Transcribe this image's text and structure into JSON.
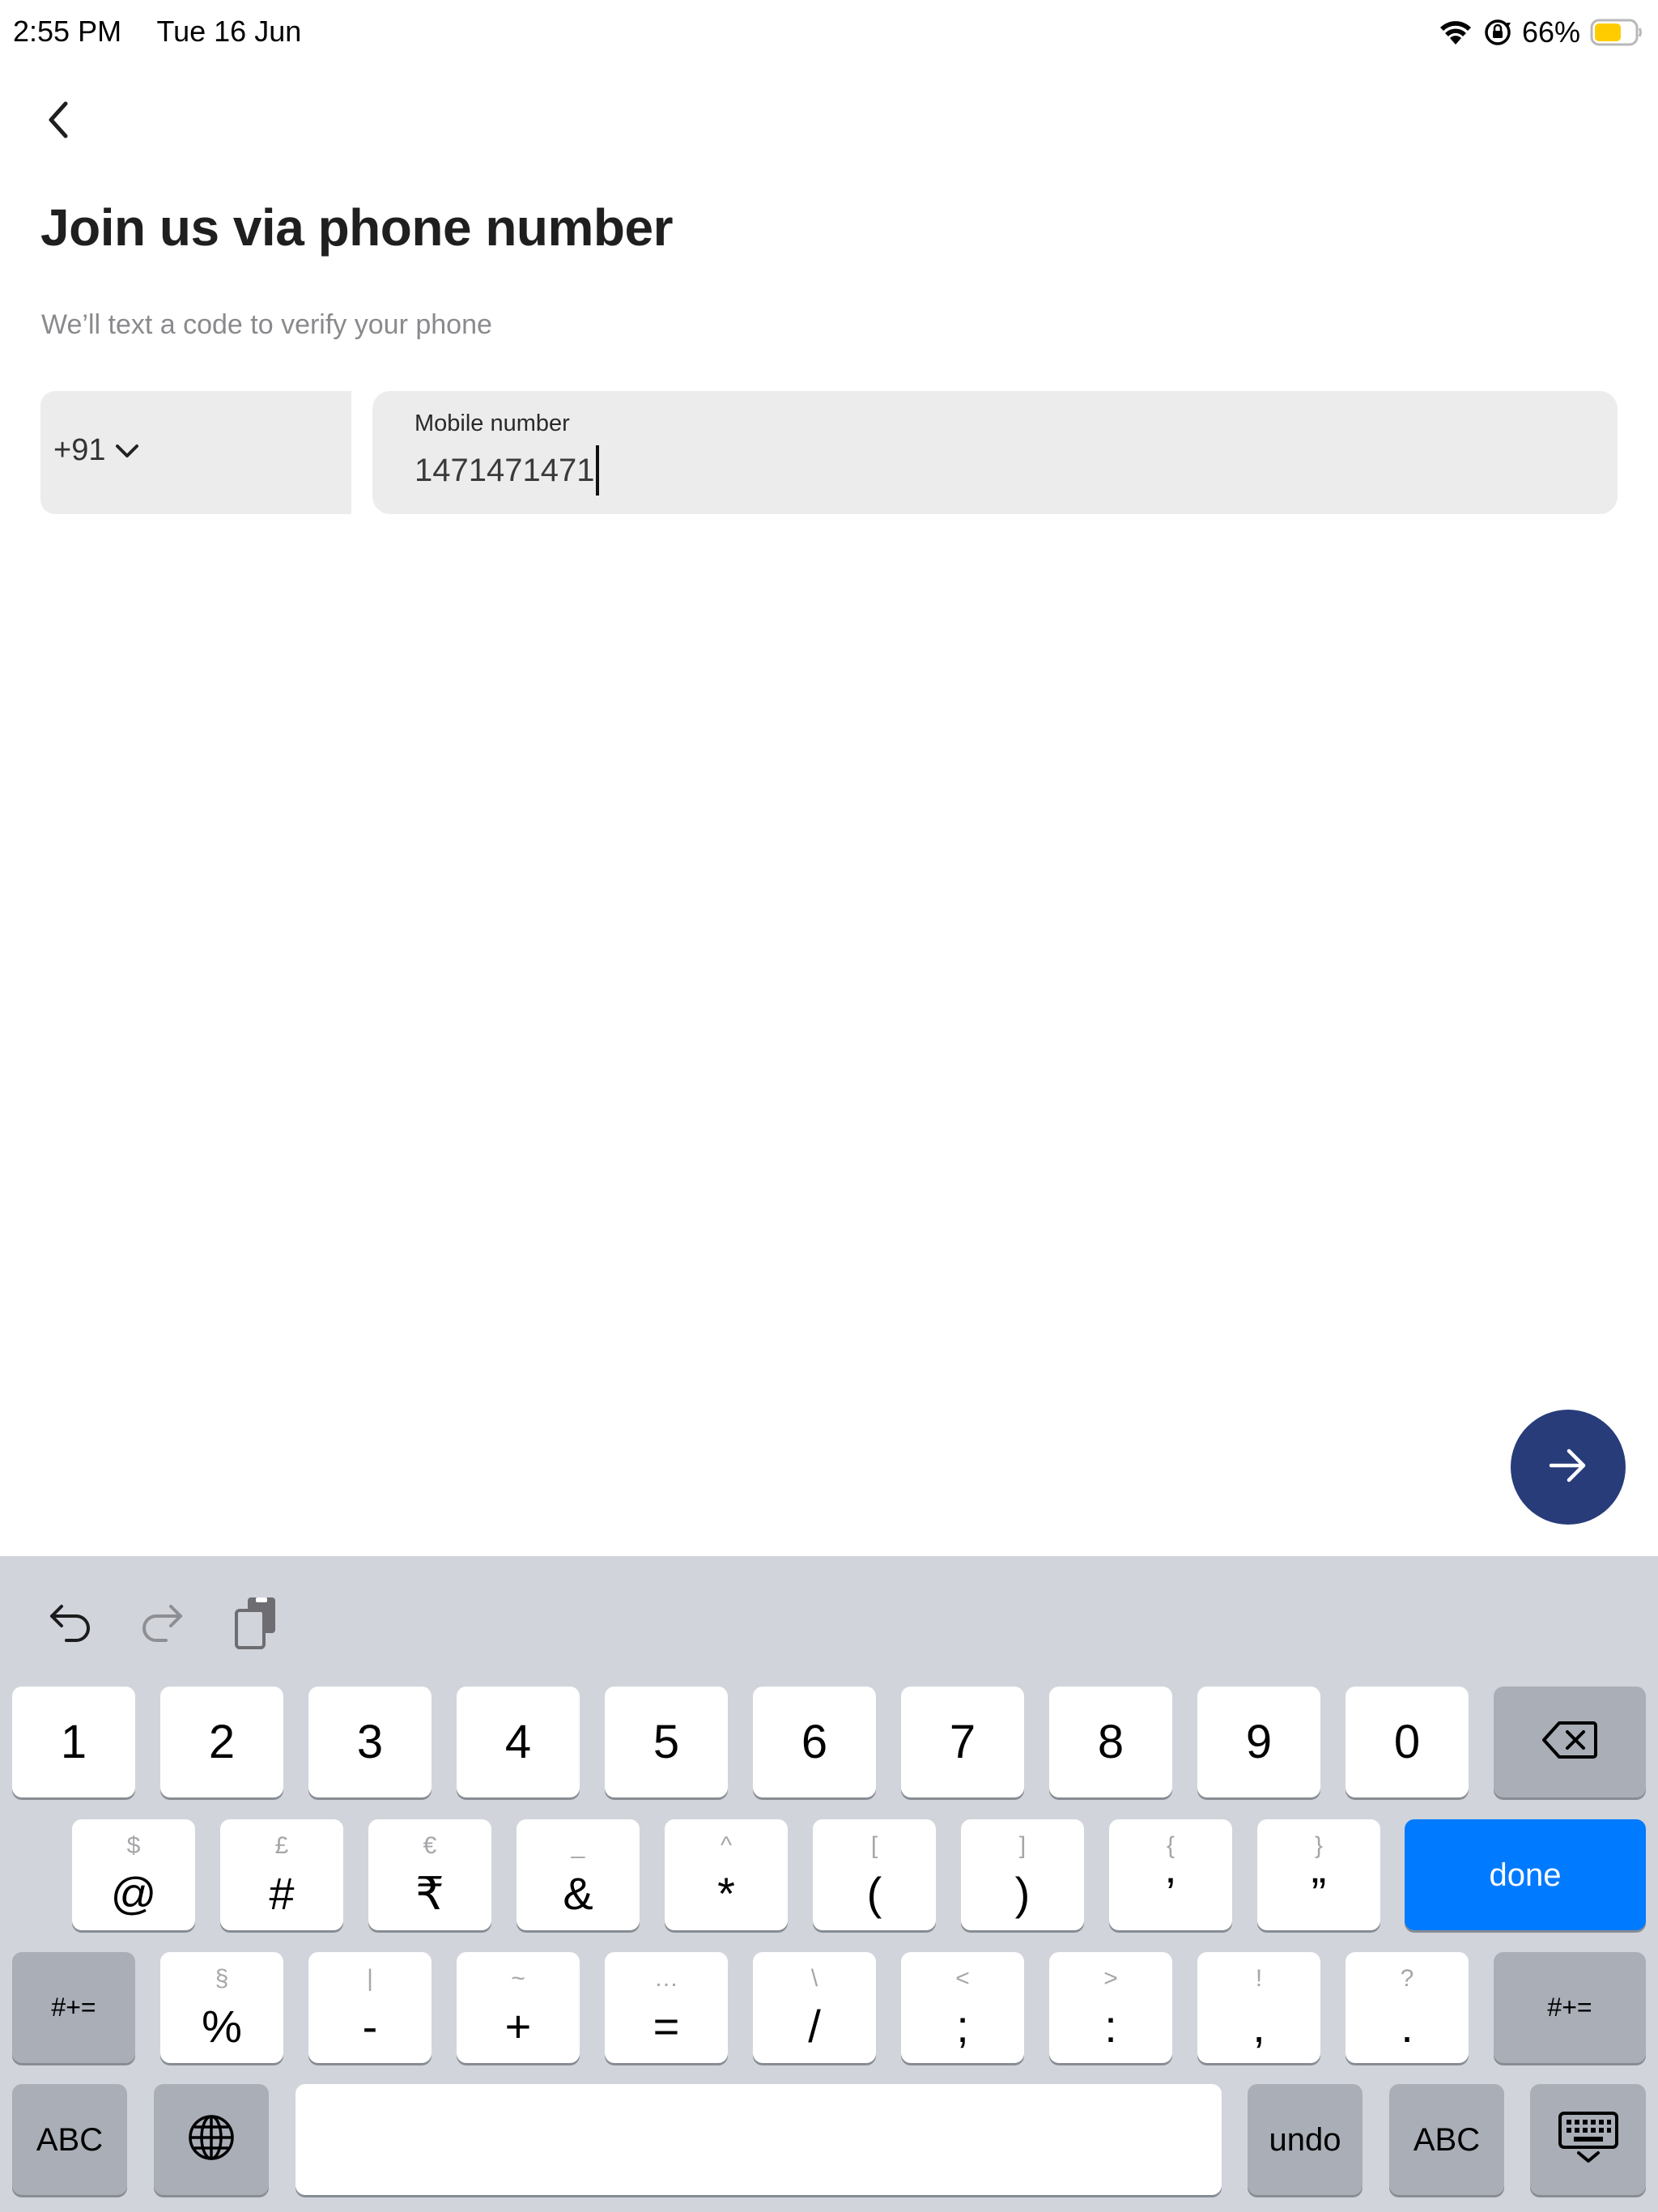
{
  "status_bar": {
    "time": "2:55 PM",
    "date": "Tue 16 Jun",
    "battery_percent": "66%",
    "battery_level": 0.66,
    "battery_color": "#ffcc00",
    "icons": [
      "wifi-icon",
      "orientation-lock-icon",
      "battery-icon"
    ]
  },
  "header": {
    "back_icon": "chevron-left-icon",
    "title": "Join us via phone number",
    "subtitle": "We’ll text a code to verify your phone"
  },
  "phone_form": {
    "country_code": "+91",
    "country_code_icon": "chevron-down-icon",
    "mobile_label": "Mobile number",
    "mobile_value": "1471471471"
  },
  "next_button": {
    "icon": "arrow-right-icon",
    "color": "#283c7a"
  },
  "keyboard": {
    "toolbar": [
      "undo-icon",
      "redo-icon",
      "paste-icon"
    ],
    "row1": [
      "1",
      "2",
      "3",
      "4",
      "5",
      "6",
      "7",
      "8",
      "9",
      "0"
    ],
    "row1_delete_icon": "backspace-icon",
    "row2": [
      {
        "alt": "$",
        "main": "@"
      },
      {
        "alt": "£",
        "main": "#"
      },
      {
        "alt": "€",
        "main": "₹"
      },
      {
        "alt": "_",
        "main": "&"
      },
      {
        "alt": "^",
        "main": "*"
      },
      {
        "alt": "[",
        "main": "("
      },
      {
        "alt": "]",
        "main": ")"
      },
      {
        "alt": "{",
        "main": "’"
      },
      {
        "alt": "}",
        "main": "”"
      }
    ],
    "done_label": "done",
    "done_color": "#007aff",
    "row3_left_label": "#+=",
    "row3": [
      {
        "alt": "§",
        "main": "%"
      },
      {
        "alt": "|",
        "main": "-"
      },
      {
        "alt": "~",
        "main": "+"
      },
      {
        "alt": "…",
        "main": "="
      },
      {
        "alt": "\\",
        "main": "/"
      },
      {
        "alt": "<",
        "main": ";"
      },
      {
        "alt": ">",
        "main": ":"
      },
      {
        "alt": "!",
        "main": ","
      },
      {
        "alt": "?",
        "main": "."
      }
    ],
    "row3_right_label": "#+=",
    "abc_label": "ABC",
    "globe_icon": "globe-icon",
    "undo_label": "undo",
    "abc_right_label": "ABC",
    "dismiss_icon": "keyboard-dismiss-icon"
  }
}
